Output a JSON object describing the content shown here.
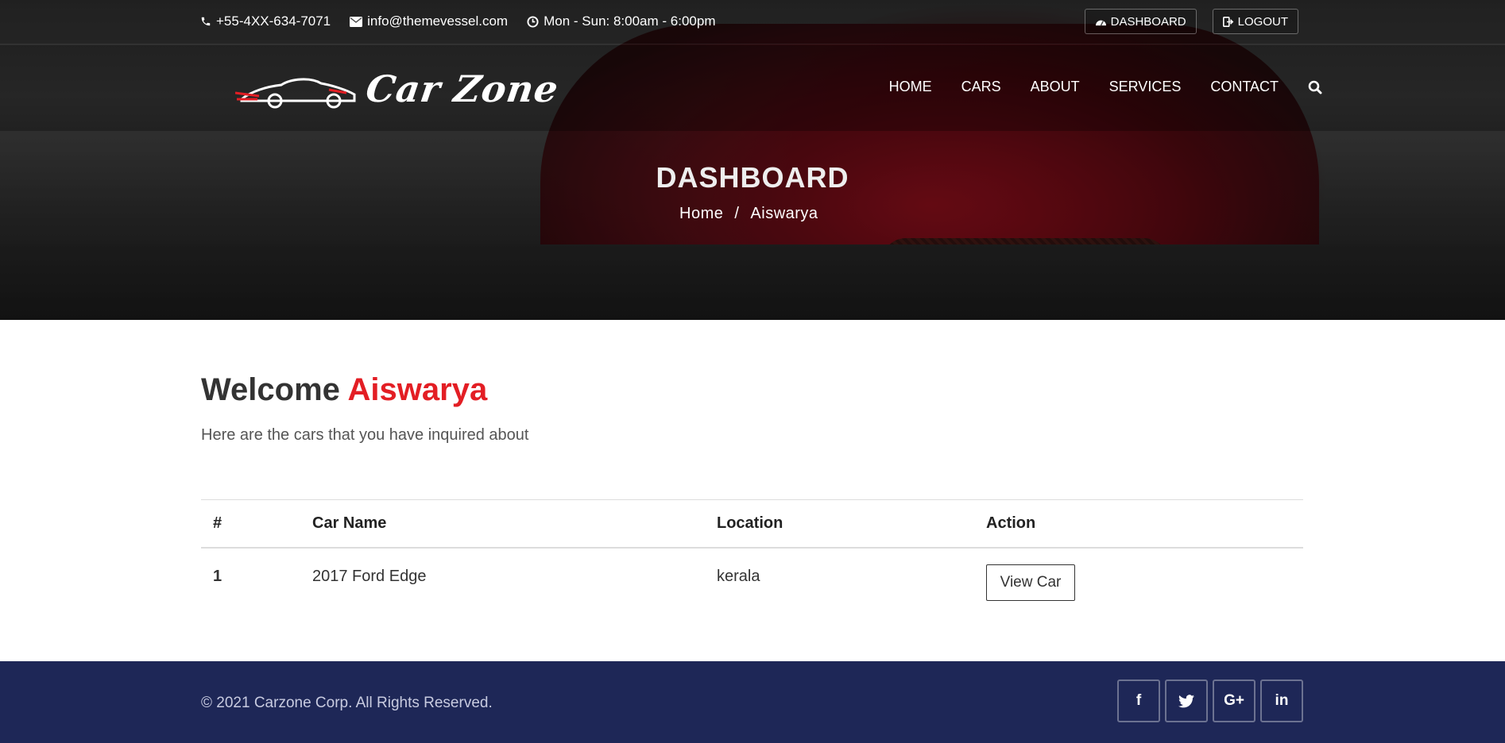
{
  "topbar": {
    "phone": "+55-4XX-634-7071",
    "email": "info@themevessel.com",
    "hours": "Mon - Sun: 8:00am - 6:00pm",
    "dashboard_label": "DASHBOARD",
    "logout_label": "LOGOUT"
  },
  "brand": {
    "name": "Car Zone"
  },
  "nav": {
    "items": [
      {
        "label": "HOME"
      },
      {
        "label": "CARS"
      },
      {
        "label": "ABOUT"
      },
      {
        "label": "SERVICES"
      },
      {
        "label": "CONTACT"
      }
    ]
  },
  "hero": {
    "title": "DASHBOARD",
    "breadcrumb": [
      {
        "label": "Home"
      },
      {
        "label": "Aiswarya"
      }
    ],
    "separator": "/"
  },
  "main": {
    "welcome_prefix": "Welcome",
    "user_name": "Aiswarya",
    "subtitle": "Here are the cars that you have inquired about",
    "table": {
      "headers": [
        "#",
        "Car Name",
        "Location",
        "Action"
      ],
      "rows": [
        {
          "num": "1",
          "car_name": "2017 Ford Edge",
          "location": "kerala",
          "action": "View Car"
        }
      ]
    }
  },
  "footer": {
    "copyright": "© 2021 Carzone Corp. All Rights Reserved.",
    "social": [
      {
        "icon": "facebook-icon",
        "glyph": "f"
      },
      {
        "icon": "twitter-icon",
        "glyph": "t"
      },
      {
        "icon": "google-plus-icon",
        "glyph": "G+"
      },
      {
        "icon": "linkedin-icon",
        "glyph": "in"
      }
    ]
  },
  "colors": {
    "accent": "#e31e24",
    "footer_bg": "#1e2757"
  }
}
